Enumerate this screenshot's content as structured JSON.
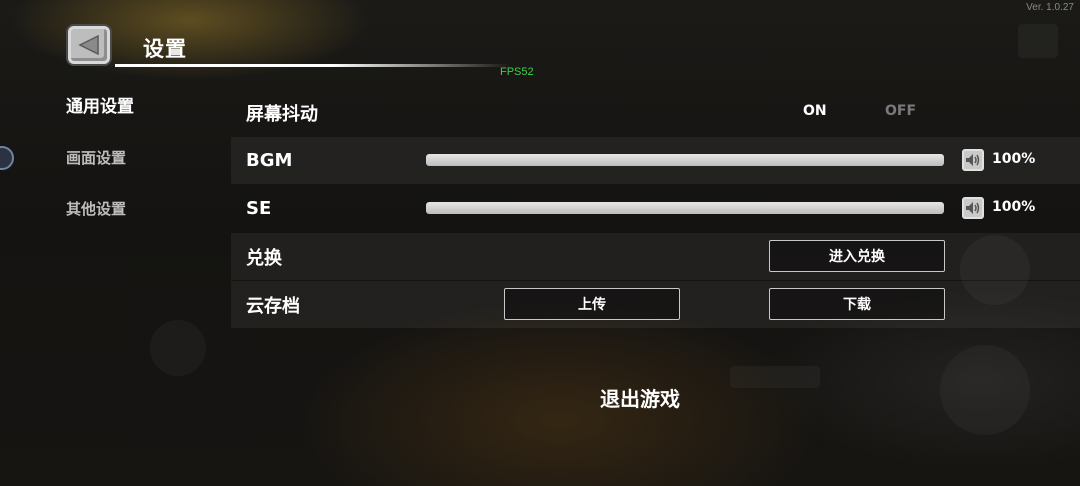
{
  "version": "Ver. 1.0.27",
  "fps": "FPS52",
  "header": {
    "title": "设置",
    "back_icon": "back-arrow-icon"
  },
  "categories": [
    {
      "label": "通用设置",
      "active": true
    },
    {
      "label": "画面设置",
      "active": false
    },
    {
      "label": "其他设置",
      "active": false
    }
  ],
  "settings": {
    "screen_shake": {
      "label": "屏幕抖动",
      "on_label": "ON",
      "off_label": "OFF",
      "selected": "ON"
    },
    "bgm": {
      "label": "BGM",
      "value_text": "100%",
      "level": 1.0,
      "icon": "speaker-icon"
    },
    "se": {
      "label": "SE",
      "value_text": "100%",
      "level": 1.0,
      "icon": "speaker-icon"
    },
    "redeem": {
      "label": "兑换",
      "button_label": "进入兑换"
    },
    "cloud_save": {
      "label": "云存档",
      "upload_label": "上传",
      "download_label": "下载"
    }
  },
  "exit_label": "退出游戏",
  "colors": {
    "fps": "#3fd04a",
    "active_toggle": "#ffffff",
    "inactive_toggle": "#7a7a7a",
    "slider_fill": "#d9d9d9"
  }
}
